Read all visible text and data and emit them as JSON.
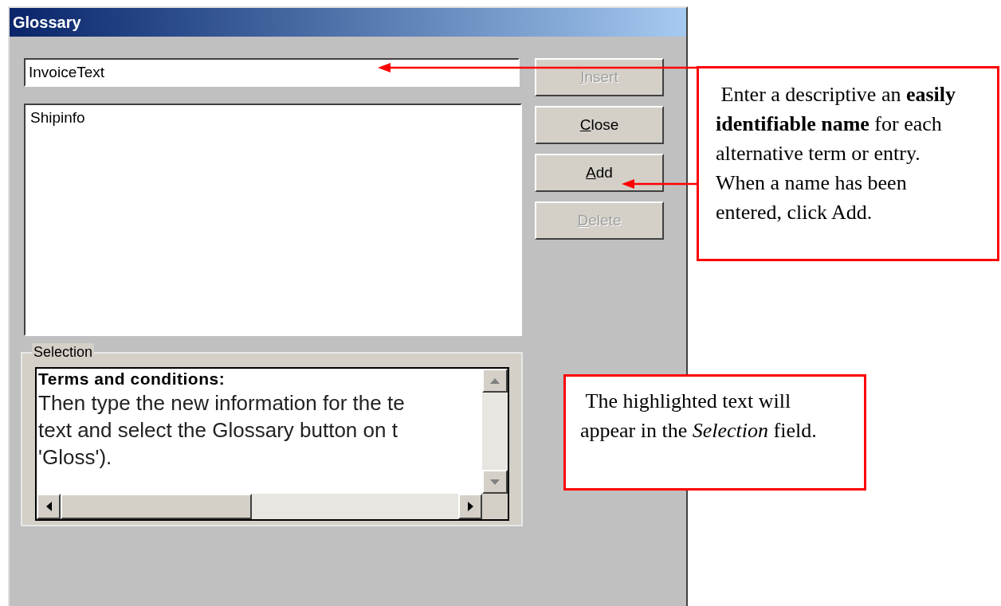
{
  "window": {
    "title": "Glossary"
  },
  "name_field": {
    "value": "InvoiceText"
  },
  "glossary_list": {
    "items": [
      {
        "label": "Shipinfo",
        "selected": false
      }
    ]
  },
  "buttons": [
    {
      "label": "Insert",
      "disabled": true
    },
    {
      "label": "Close",
      "disabled": false
    },
    {
      "label": "Add",
      "disabled": false
    },
    {
      "label": "Delete",
      "disabled": true
    }
  ],
  "selection": {
    "label": "Selection",
    "heading": "Terms and conditions:",
    "lines": [
      "Then type the new information for the te",
      "text and select the Glossary button on t",
      "'Gloss')."
    ]
  },
  "callouts": [
    {
      "text": " Enter a descriptive an **easily identifiable name** for each alternative term or entry. When a name has been entered, click Add."
    },
    {
      "text": " The highlighted text will appear in the *Selection* field."
    }
  ]
}
